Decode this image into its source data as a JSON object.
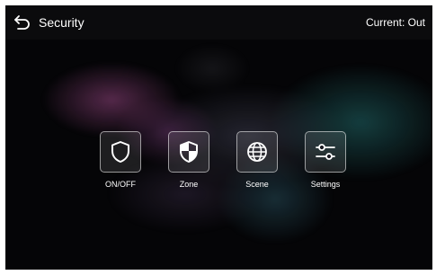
{
  "header": {
    "title": "Security",
    "current_label": "Current:",
    "current_value": "Out"
  },
  "icons": {
    "back": "back-arrow-icon",
    "onoff": "shield-icon",
    "zone": "shield-half-icon",
    "scene": "globe-icon",
    "settings": "sliders-icon"
  },
  "menu": [
    {
      "label": "ON/OFF"
    },
    {
      "label": "Zone"
    },
    {
      "label": "Scene"
    },
    {
      "label": "Settings"
    }
  ],
  "colors": {
    "background": "#050507",
    "header": "#0b0b0d",
    "text": "#ffffff"
  }
}
